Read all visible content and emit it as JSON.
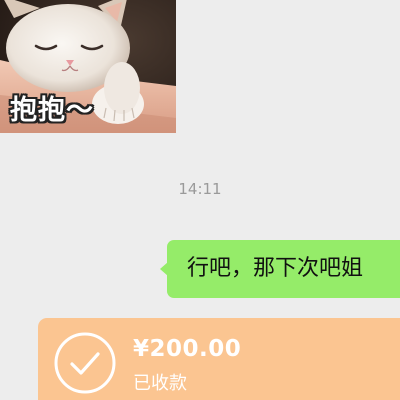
{
  "chat": {
    "sticker": {
      "caption": "抱抱～",
      "icon": "kitten-sticker-image"
    },
    "timestamp": "14:11",
    "outgoing_message": {
      "text": "行吧，那下次吧姐",
      "bubble_color": "#95ec69"
    },
    "transfer": {
      "amount": "¥200.00",
      "status": "已收款",
      "icon": "check-circle-icon",
      "card_color": "#fbc591"
    }
  },
  "colors": {
    "background": "#ededed",
    "timestamp_text": "#9a9a9a"
  }
}
